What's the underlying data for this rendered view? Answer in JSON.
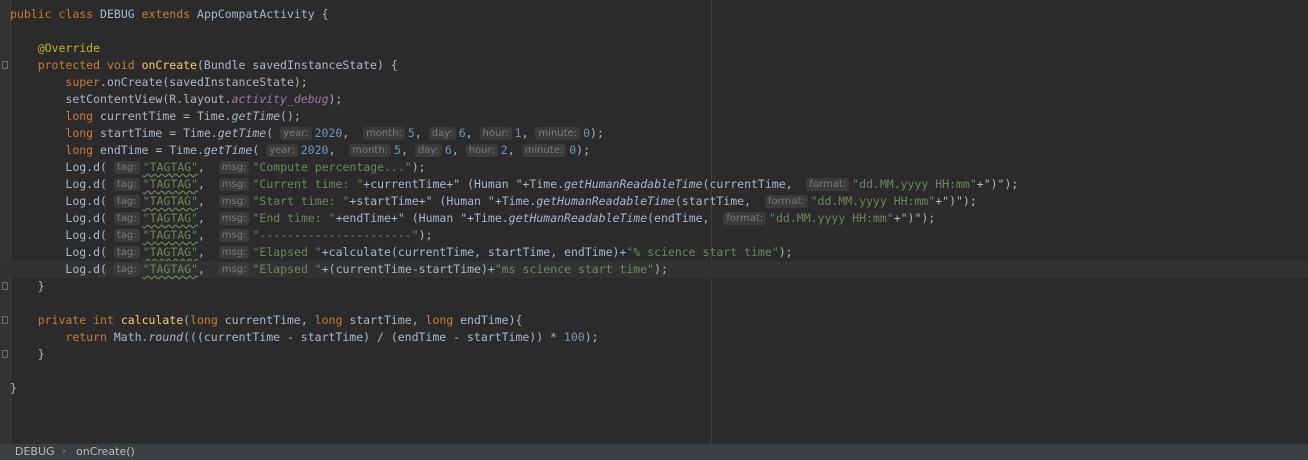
{
  "editor": {
    "class_keywords": [
      "public",
      "class",
      "extends"
    ],
    "class_name": "DEBUG",
    "parent_class": "AppCompatActivity",
    "annotation": "@Override",
    "oncreate_signature": {
      "modifiers": "protected void",
      "name": "onCreate",
      "params": "(Bundle savedInstanceState) {"
    },
    "super_call": {
      "kw": "super",
      "rest": ".onCreate(savedInstanceState);"
    },
    "set_content": {
      "pre": "setContentView(R.layout.",
      "field": "activity_debug",
      "post": ");"
    },
    "current_time": {
      "kw": "long",
      "pre": " currentTime = Time.",
      "method": "getTime",
      "post": "();"
    },
    "start_time": {
      "kw": "long",
      "pre": " startTime = Time.",
      "method": "getTime",
      "open": "(",
      "args": [
        {
          "hint": "year:",
          "value": "2020"
        },
        {
          "hint": "month:",
          "value": "5"
        },
        {
          "hint": "day:",
          "value": "6"
        },
        {
          "hint": "hour:",
          "value": "1"
        },
        {
          "hint": "minute:",
          "value": "0"
        }
      ],
      "close": ");"
    },
    "end_time": {
      "kw": "long",
      "pre": " endTime = Time.",
      "method": "getTime",
      "open": "(",
      "args": [
        {
          "hint": "year:",
          "value": "2020"
        },
        {
          "hint": "month:",
          "value": "5"
        },
        {
          "hint": "day:",
          "value": "6"
        },
        {
          "hint": "hour:",
          "value": "2"
        },
        {
          "hint": "minute:",
          "value": "0"
        }
      ],
      "close": ");"
    },
    "log_calls": {
      "prefix": "Log.d(",
      "tag_hint": "tag:",
      "msg_hint": "msg:",
      "tag_value": "\"TAGTAG\"",
      "lines": [
        {
          "msg": "\"Compute percentage...\"",
          "rest": ");"
        },
        {
          "msg": "\"Current time: \"",
          "rest": "+currentTime+\" (Human \"+Time.",
          "method": "getHumanReadableTime",
          "rest2": "(currentTime, ",
          "format_hint": "format:",
          "format": "\"dd.MM.yyyy HH:mm\"",
          "rest3": "+\")\");"
        },
        {
          "msg": "\"Start time: \"",
          "rest": "+startTime+\" (Human \"+Time.",
          "method": "getHumanReadableTime",
          "rest2": "(startTime, ",
          "format_hint": "format:",
          "format": "\"dd.MM.yyyy HH:mm\"",
          "rest3": "+\")\");"
        },
        {
          "msg": "\"End time: \"",
          "rest": "+endTime+\" (Human \"+Time.",
          "method": "getHumanReadableTime",
          "rest2": "(endTime, ",
          "format_hint": "format:",
          "format": "\"dd.MM.yyyy HH:mm\"",
          "rest3": "+\")\");"
        },
        {
          "msg": "\"----------------------\"",
          "rest": ");"
        },
        {
          "msg": "\"Elapsed \"",
          "rest": "+calculate(currentTime, startTime, endTime)+",
          "str2": "\"% science start time\"",
          "rest3": ");"
        },
        {
          "msg": "\"Elapsed \"",
          "rest": "+(currentTime-startTime)+",
          "str2": "\"ms science start time\"",
          "rest3": ");"
        }
      ]
    },
    "close_brace": "}",
    "calculate_signature": {
      "modifiers": "private int",
      "name": "calculate",
      "p1": "(",
      "t1": "long",
      "n1": " currentTime, ",
      "t2": "long",
      "n2": " startTime, ",
      "t3": "long",
      "n3": " endTime){"
    },
    "return_line": {
      "kw": "return",
      "pre": " Math.",
      "method": "round",
      "post": "(((currentTime - startTime) / (endTime - startTime)) * ",
      "num": "100",
      "end": ");"
    }
  },
  "breadcrumb": {
    "items": [
      "DEBUG",
      "onCreate()"
    ],
    "separator": "›"
  }
}
